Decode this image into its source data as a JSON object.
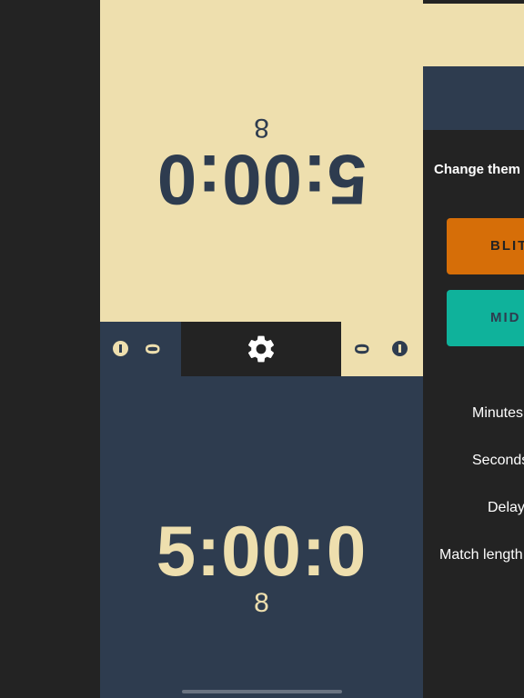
{
  "top_player": {
    "time": "5:00:0",
    "tenths": "8"
  },
  "bottom_player": {
    "time": "5:00:0",
    "tenths": "8"
  },
  "control_bar": {
    "left_moves": "0",
    "right_moves": "0"
  },
  "icons": {
    "settings": "gear-icon",
    "pause": "pause-icon"
  },
  "colors": {
    "cream": "#eedfae",
    "navy": "#2e3c4f",
    "dark": "#232323",
    "blitz": "#d66e08",
    "mid": "#0fb29b"
  },
  "settings_panel": {
    "change_theme_label": "Change them",
    "themes": [
      {
        "label": "BLIT"
      },
      {
        "label": "MID"
      }
    ],
    "fields": {
      "minutes": "Minutes",
      "seconds": "Seconds",
      "delay": "Delay",
      "match_length": "Match length"
    }
  }
}
